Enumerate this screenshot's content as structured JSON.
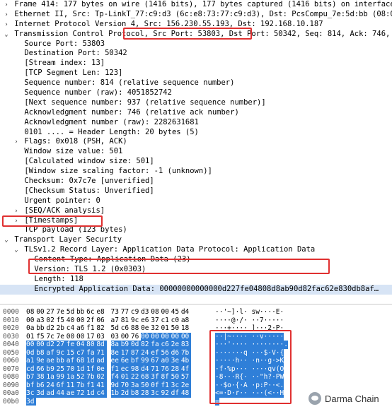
{
  "tree": [
    {
      "text": "Frame 414: 177 bytes on wire (1416 bits), 177 bytes captured (1416 bits) on interface \\Device\\NPF_{531E",
      "toggle": "right",
      "level": 0
    },
    {
      "text": "Ethernet II, Src: Tp-LinkT_77:c9:d3 (6c:e8:73:77:c9:d3), Dst: PcsCompu_7e:5d:bb (08:00:27:7e:5d:bb)",
      "toggle": "right",
      "level": 0
    },
    {
      "text": "Internet Protocol Version 4, Src: 156.230.55.193, Dst: 192.168.10.187",
      "toggle": "right",
      "level": 0
    },
    {
      "text": "Transmission Control Protocol, Src Port: 53803, Dst Port: 50342, Seq: 814, Ack: 746, Len: 123",
      "toggle": "down",
      "level": 0
    },
    {
      "text": "Source Port: 53803",
      "toggle": "",
      "level": 1
    },
    {
      "text": "Destination Port: 50342",
      "toggle": "",
      "level": 1
    },
    {
      "text": "[Stream index: 13]",
      "toggle": "",
      "level": 1
    },
    {
      "text": "[TCP Segment Len: 123]",
      "toggle": "",
      "level": 1
    },
    {
      "text": "Sequence number: 814    (relative sequence number)",
      "toggle": "",
      "level": 1
    },
    {
      "text": "Sequence number (raw): 4051852742",
      "toggle": "",
      "level": 1
    },
    {
      "text": "[Next sequence number: 937    (relative sequence number)]",
      "toggle": "",
      "level": 1
    },
    {
      "text": "Acknowledgment number: 746    (relative ack number)",
      "toggle": "",
      "level": 1
    },
    {
      "text": "Acknowledgment number (raw): 2282631681",
      "toggle": "",
      "level": 1
    },
    {
      "text": "0101 .... = Header Length: 20 bytes (5)",
      "toggle": "",
      "level": 1
    },
    {
      "text": "Flags: 0x018 (PSH, ACK)",
      "toggle": "right",
      "level": 1
    },
    {
      "text": "Window size value: 501",
      "toggle": "",
      "level": 1
    },
    {
      "text": "[Calculated window size: 501]",
      "toggle": "",
      "level": 1
    },
    {
      "text": "[Window size scaling factor: -1 (unknown)]",
      "toggle": "",
      "level": 1
    },
    {
      "text": "Checksum: 0x7c7e [unverified]",
      "toggle": "",
      "level": 1
    },
    {
      "text": "[Checksum Status: Unverified]",
      "toggle": "",
      "level": 1
    },
    {
      "text": "Urgent pointer: 0",
      "toggle": "",
      "level": 1
    },
    {
      "text": "[SEQ/ACK analysis]",
      "toggle": "right",
      "level": 1
    },
    {
      "text": "[Timestamps]",
      "toggle": "right",
      "level": 1
    },
    {
      "text": "TCP payload (123 bytes)",
      "toggle": "",
      "level": 1
    },
    {
      "text": "Transport Layer Security",
      "toggle": "down",
      "level": 0
    },
    {
      "text": "TLSv1.2 Record Layer: Application Data Protocol: Application Data",
      "toggle": "down",
      "level": 1
    },
    {
      "text": "Content Type: Application Data (23)",
      "toggle": "",
      "level": 2
    },
    {
      "text": "Version: TLS 1.2 (0x0303)",
      "toggle": "",
      "level": 2
    },
    {
      "text": "Length: 118",
      "toggle": "",
      "level": 2
    },
    {
      "text": "Encrypted Application Data: 00000000000000d227fe04808d8ab90d82fac62e830db8af…",
      "toggle": "",
      "level": 2,
      "selected": true
    }
  ],
  "hex_rows": [
    {
      "offset": "0000",
      "bytes": [
        "08",
        "00",
        "27",
        "7e",
        "5d",
        "bb",
        "6c",
        "e8",
        "73",
        "77",
        "c9",
        "d3",
        "08",
        "00",
        "45",
        "d4"
      ],
      "ascii": "··'~]·l· sw····E·",
      "hl_from": 16
    },
    {
      "offset": "0010",
      "bytes": [
        "00",
        "a3",
        "02",
        "f5",
        "40",
        "00",
        "2f",
        "06",
        "a7",
        "81",
        "9c",
        "e6",
        "37",
        "c1",
        "c0",
        "a8"
      ],
      "ascii": "····@·/· ··7·····",
      "hl_from": 16
    },
    {
      "offset": "0020",
      "bytes": [
        "0a",
        "bb",
        "d2",
        "2b",
        "c4",
        "a6",
        "f1",
        "82",
        "5d",
        "c6",
        "88",
        "0e",
        "32",
        "01",
        "50",
        "18"
      ],
      "ascii": "···+···· ]···2·P·",
      "hl_from": 16
    },
    {
      "offset": "0030",
      "bytes": [
        "01",
        "f5",
        "7c",
        "7e",
        "00",
        "00",
        "17",
        "03",
        "03",
        "00",
        "76",
        "00",
        "00",
        "00",
        "00",
        "00"
      ],
      "ascii": "··|~···· ··v·····",
      "hl_from": 11
    },
    {
      "offset": "0040",
      "bytes": [
        "00",
        "00",
        "d2",
        "27",
        "fe",
        "04",
        "80",
        "8d",
        "8a",
        "b9",
        "0d",
        "82",
        "fa",
        "c6",
        "2e",
        "83"
      ],
      "ascii": "···'···· ········.",
      "hl_from": 0
    },
    {
      "offset": "0050",
      "bytes": [
        "0d",
        "b8",
        "af",
        "9c",
        "15",
        "c7",
        "fa",
        "71",
        "8e",
        "17",
        "87",
        "24",
        "ef",
        "56",
        "d6",
        "7b"
      ],
      "ascii": "·······q ···$·V·{",
      "hl_from": 0
    },
    {
      "offset": "0060",
      "bytes": [
        "a1",
        "9e",
        "ae",
        "bb",
        "af",
        "68",
        "1d",
        "ad",
        "ee",
        "6e",
        "bf",
        "99",
        "67",
        "a0",
        "3e",
        "4b"
      ],
      "ascii": "·····h·· ·n··g·>K",
      "hl_from": 0
    },
    {
      "offset": "0070",
      "bytes": [
        "cd",
        "66",
        "b9",
        "25",
        "70",
        "1d",
        "1f",
        "0e",
        "f1",
        "ec",
        "98",
        "d4",
        "71",
        "76",
        "28",
        "4f"
      ],
      "ascii": "·f·%p··· ····qv(O",
      "hl_from": 0
    },
    {
      "offset": "0080",
      "bytes": [
        "b7",
        "38",
        "1a",
        "99",
        "1a",
        "52",
        "7b",
        "02",
        "f4",
        "01",
        "22",
        "68",
        "3f",
        "8f",
        "50",
        "57"
      ],
      "ascii": "·8···R{· ··\"h?·PW",
      "hl_from": 0
    },
    {
      "offset": "0090",
      "bytes": [
        "bf",
        "b6",
        "24",
        "6f",
        "11",
        "7b",
        "f1",
        "41",
        "9d",
        "70",
        "3a",
        "50",
        "0f",
        "f1",
        "3c",
        "2e"
      ],
      "ascii": "··$o·{·A ·p:P··<.",
      "hl_from": 0
    },
    {
      "offset": "00a0",
      "bytes": [
        "3c",
        "3d",
        "ad",
        "44",
        "ae",
        "72",
        "1d",
        "c4",
        "1b",
        "2d",
        "b8",
        "28",
        "3c",
        "92",
        "df",
        "48"
      ],
      "ascii": "<=·D·r·· ·-·(<··H",
      "hl_from": 0
    },
    {
      "offset": "00b0",
      "bytes": [
        "3d"
      ],
      "ascii": "=",
      "hl_from": 0
    }
  ],
  "watermark": {
    "text": "Darma Chain"
  },
  "colors": {
    "highlight": "#2f7fd8",
    "annotation": "#e03030",
    "selected_row": "#d7e4f5"
  }
}
